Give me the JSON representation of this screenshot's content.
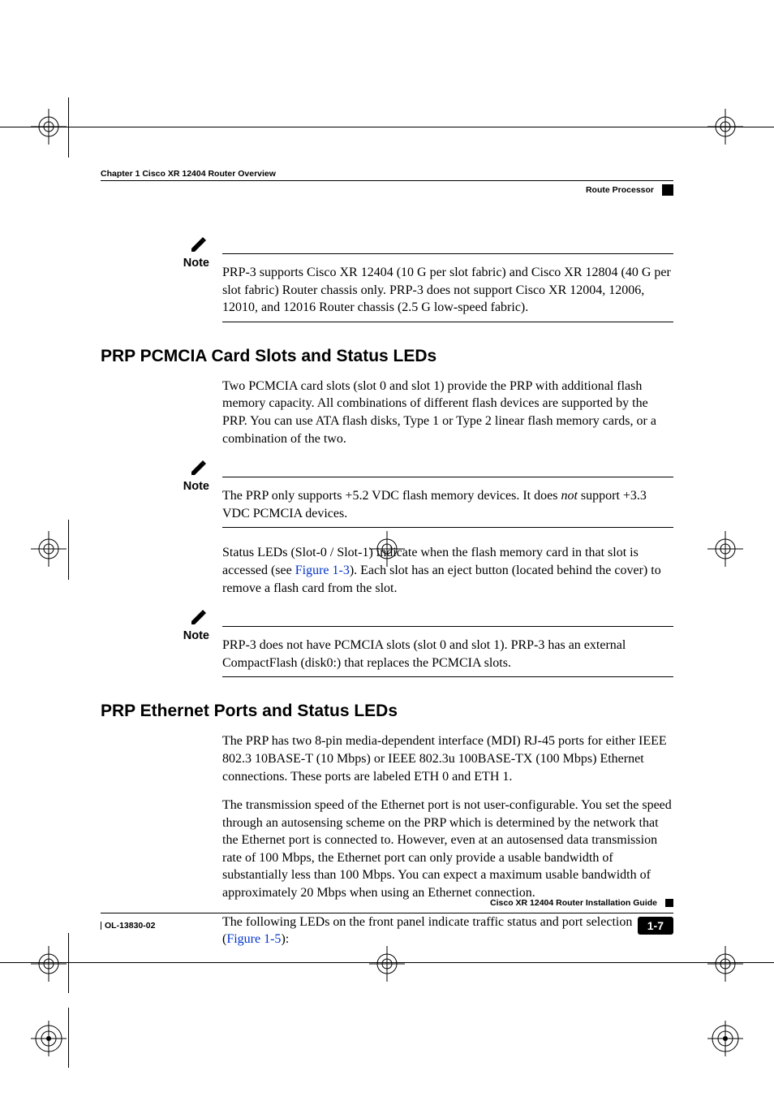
{
  "header": {
    "chapter": "Chapter 1      Cisco XR 12404 Router Overview",
    "section": "Route Processor"
  },
  "notes": {
    "label": "Note",
    "n1_text": "PRP-3 supports Cisco XR 12404 (10 G per slot fabric) and Cisco XR 12804 (40 G per slot fabric) Router chassis only. PRP-3 does not support Cisco XR 12004, 12006, 12010, and 12016 Router chassis (2.5 G low-speed fabric).",
    "n2_before": "The PRP only supports +5.2 VDC flash memory devices. It does ",
    "n2_em": "not",
    "n2_after": " support +3.3 VDC PCMCIA devices.",
    "n3_text": "PRP-3 does not have PCMCIA slots (slot 0 and slot 1). PRP-3 has an external CompactFlash (disk0:) that replaces the PCMCIA slots."
  },
  "sections": {
    "h1": "PRP PCMCIA Card Slots and Status LEDs",
    "p1": "Two PCMCIA card slots (slot 0 and slot 1) provide the PRP with additional flash memory capacity. All combinations of different flash devices are supported by the PRP. You can use ATA flash disks, Type 1 or Type 2 linear flash memory cards, or a combination of the two.",
    "p2_before": "Status LEDs (Slot-0 / Slot-1) indicate when the flash memory card in that slot is accessed (see ",
    "p2_link": "Figure 1-3",
    "p2_after": "). Each slot has an eject button (located behind the cover) to remove a flash card from the slot.",
    "h2": "PRP Ethernet Ports and Status LEDs",
    "p3": "The PRP has two 8-pin media-dependent interface (MDI) RJ-45 ports for either IEEE 802.3 10BASE-T (10 Mbps) or IEEE 802.3u 100BASE-TX (100 Mbps) Ethernet connections. These ports are labeled ETH 0 and ETH 1.",
    "p4": "The transmission speed of the Ethernet port is not user-configurable. You set the speed through an autosensing scheme on the PRP which is determined by the network that the Ethernet port is connected to. However, even at an autosensed data transmission rate of 100 Mbps, the Ethernet port can only provide a usable bandwidth of substantially less than 100 Mbps. You can expect a maximum usable bandwidth of approximately 20 Mbps when using an Ethernet connection.",
    "p5_before": "The following LEDs on the front panel indicate traffic status and port selection (",
    "p5_link": "Figure 1-5",
    "p5_after": "):"
  },
  "footer": {
    "guide": "Cisco XR 12404 Router Installation Guide",
    "doc": "OL-13830-02",
    "page": "1-7"
  }
}
